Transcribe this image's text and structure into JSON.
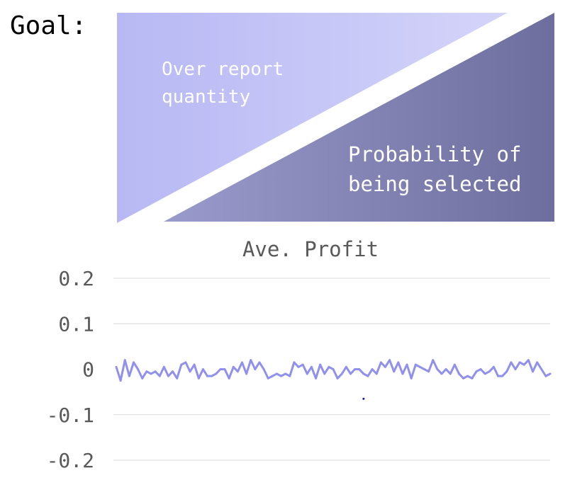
{
  "goal_label": "Goal:",
  "diagram": {
    "upper_label_line1": "Over report",
    "upper_label_line2": "quantity",
    "lower_label_line1": "Probability of",
    "lower_label_line2": "being selected",
    "upper_color_start": "#B8B8F4",
    "upper_color_end": "#D4D4FA",
    "lower_color_start": "#9A9ACC",
    "lower_color_end": "#6E6E9E"
  },
  "chart_data": {
    "type": "line",
    "title": "Ave. Profit",
    "xlabel": "",
    "ylabel": "",
    "ylim": [
      -0.2,
      0.2
    ],
    "ytick_labels": [
      "0.2",
      "0.1",
      "0",
      "-0.1",
      "-0.2"
    ],
    "ytick_values": [
      0.2,
      0.1,
      0,
      -0.1,
      -0.2
    ],
    "grid": true,
    "legend": "none",
    "line_color": "#9090EE",
    "series": [
      {
        "values": [
          0.005,
          -0.025,
          0.02,
          -0.015,
          0.015,
          0.0,
          -0.02,
          -0.005,
          -0.01,
          -0.005,
          -0.015,
          0.005,
          -0.015,
          -0.005,
          -0.02,
          0.01,
          0.015,
          -0.005,
          0.01,
          -0.02,
          0.0,
          -0.015,
          -0.015,
          -0.01,
          0.0,
          0.0,
          -0.02,
          0.005,
          -0.005,
          0.015,
          -0.01,
          0.02,
          0.0,
          0.015,
          0.0,
          -0.02,
          -0.015,
          -0.01,
          -0.015,
          -0.01,
          -0.015,
          0.015,
          0.005,
          0.01,
          -0.01,
          0.005,
          -0.02,
          0.01,
          -0.01,
          0.005,
          0.0,
          -0.02,
          -0.01,
          0.005,
          -0.01,
          0.0,
          0.0,
          -0.01,
          -0.015,
          0.0,
          -0.01,
          0.015,
          0.005,
          0.02,
          -0.005,
          0.015,
          -0.01,
          0.01,
          -0.02,
          0.01,
          0.005,
          0.0,
          -0.005,
          0.02,
          0.0,
          -0.01,
          0.0,
          -0.01,
          0.01,
          -0.01,
          -0.02,
          -0.015,
          -0.02,
          -0.005,
          0.0,
          -0.01,
          -0.005,
          0.005,
          -0.015,
          -0.015,
          -0.005,
          0.015,
          0.0,
          0.015,
          0.01,
          0.02,
          -0.005,
          0.015,
          0.0,
          -0.015,
          -0.01
        ]
      }
    ],
    "stray_point": {
      "x_index": 57,
      "y": -0.065,
      "color": "#1a1aa0"
    }
  }
}
